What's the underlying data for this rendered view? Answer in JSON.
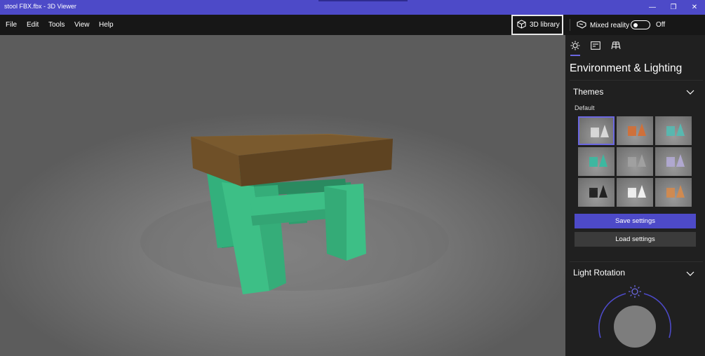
{
  "window": {
    "title": "stool FBX.fbx - 3D Viewer",
    "minimize_glyph": "—",
    "restore_glyph": "❐",
    "close_glyph": "✕"
  },
  "menu": {
    "items": [
      "File",
      "Edit",
      "Tools",
      "View",
      "Help"
    ]
  },
  "toolbar": {
    "library_label": "3D library",
    "library_icon": "cube-icon",
    "mixed_reality_label": "Mixed reality",
    "mixed_reality_icon": "headset-icon",
    "mixed_reality_state": "Off"
  },
  "panel": {
    "tabs": [
      {
        "icon": "sun-icon",
        "active": true
      },
      {
        "icon": "stats-icon",
        "active": false
      },
      {
        "icon": "grid-icon",
        "active": false
      }
    ],
    "heading": "Environment & Lighting",
    "themes": {
      "title": "Themes",
      "selected_label": "Default",
      "thumbnails": [
        {
          "name": "default",
          "accent": "#d8d8d8",
          "selected": true
        },
        {
          "name": "warm",
          "accent": "#d0703a",
          "selected": false
        },
        {
          "name": "cool",
          "accent": "#58b8b0",
          "selected": false
        },
        {
          "name": "teal",
          "accent": "#3cb8a0",
          "selected": false
        },
        {
          "name": "grey",
          "accent": "#a0a0a0",
          "selected": false
        },
        {
          "name": "lavender",
          "accent": "#b0a8d0",
          "selected": false
        },
        {
          "name": "dark",
          "accent": "#222222",
          "selected": false
        },
        {
          "name": "white",
          "accent": "#f0f0f0",
          "selected": false
        },
        {
          "name": "sunset",
          "accent": "#d08a50",
          "selected": false
        }
      ]
    },
    "save_button": "Save settings",
    "load_button": "Load settings",
    "light_rotation": {
      "title": "Light Rotation"
    }
  },
  "colors": {
    "accent": "#4d4ac8",
    "model_seat": "#7a5a2e",
    "model_legs": "#3dbf86"
  }
}
